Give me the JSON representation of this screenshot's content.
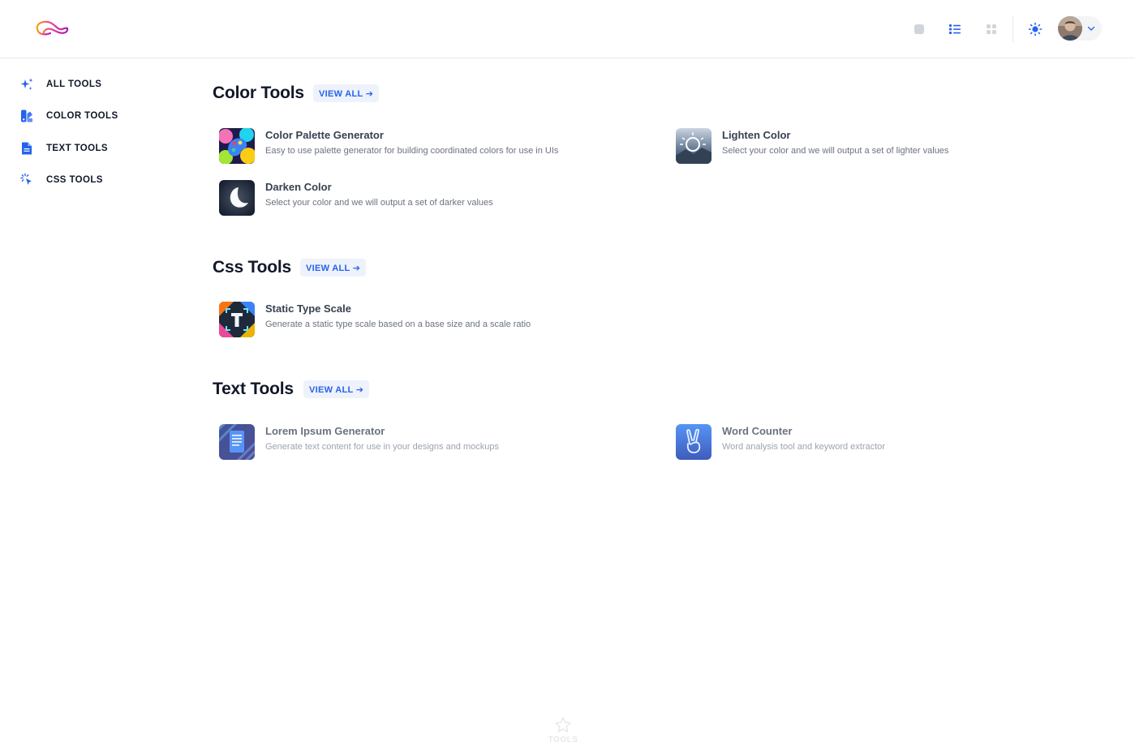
{
  "header": {
    "icons": [
      "logo-icon",
      "square-view-icon",
      "list-view-icon",
      "grid-view-icon",
      "sun-icon",
      "chevron-down-icon"
    ]
  },
  "sidebar": {
    "items": [
      {
        "label": "ALL TOOLS",
        "icon": "sparkles-icon"
      },
      {
        "label": "COLOR TOOLS",
        "icon": "swatch-icon"
      },
      {
        "label": "TEXT TOOLS",
        "icon": "document-icon"
      },
      {
        "label": "CSS TOOLS",
        "icon": "cursor-click-icon"
      }
    ]
  },
  "sections": {
    "color": {
      "title": "Color Tools",
      "view_all": "VIEW ALL ➔",
      "tools": [
        {
          "name": "Color Palette Generator",
          "desc": "Easy to use palette generator for building coordinated colors for use in UIs"
        },
        {
          "name": "Lighten Color",
          "desc": "Select your color and we will output a set of lighter values"
        },
        {
          "name": "Darken Color",
          "desc": "Select your color and we will output a set of darker values"
        }
      ]
    },
    "css": {
      "title": "Css Tools",
      "view_all": "VIEW ALL ➔",
      "tools": [
        {
          "name": "Static Type Scale",
          "desc": "Generate a static type scale based on a base size and a scale ratio"
        }
      ]
    },
    "text": {
      "title": "Text Tools",
      "view_all": "VIEW ALL ➔",
      "tools": [
        {
          "name": "Lorem Ipsum Generator",
          "desc": "Generate text content for use in your designs and mockups"
        },
        {
          "name": "Word Counter",
          "desc": "Word analysis tool and keyword extractor"
        }
      ]
    }
  },
  "bottom_nav": {
    "label": "TOOLS",
    "icon": "star-icon"
  },
  "colors": {
    "accent": "#2563eb",
    "badge_bg": "#eef2fb"
  }
}
